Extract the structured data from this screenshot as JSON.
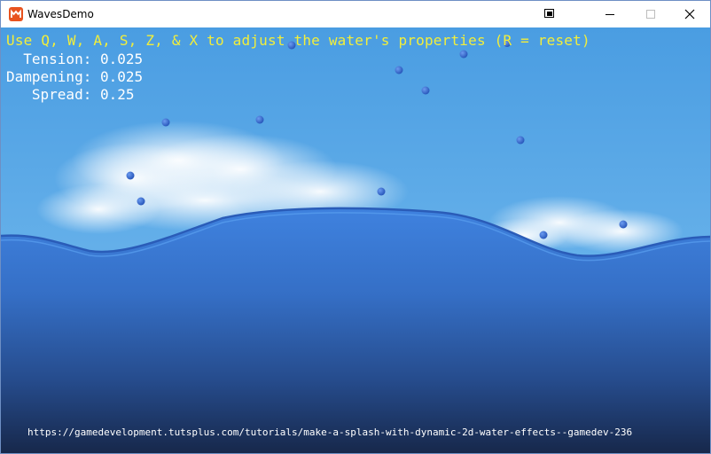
{
  "window": {
    "title": "WavesDemo",
    "controls": {
      "extra_icon": "snap-layout-icon",
      "minimize_icon": "minimize-icon",
      "maximize_icon": "maximize-icon",
      "close_icon": "close-icon"
    }
  },
  "hud": {
    "hint": "Use Q, W, A, S, Z, & X to adjust the water's properties (R = reset)",
    "tension_label": "  Tension:",
    "tension_value": "0.025",
    "dampening_label": "Dampening:",
    "dampening_value": "0.025",
    "spread_label": "   Spread:",
    "spread_value": "0.25",
    "url": "https://gamedevelopment.tutsplus.com/tutorials/make-a-splash-with-dynamic-2d-water-effects--gamedev-236"
  },
  "colors": {
    "sky_top": "#4b9ee2",
    "sky_bottom": "#6fb7ee",
    "water_top": "#3f7fdc",
    "water_bottom": "#1a2f58",
    "droplet": "#2f63c9",
    "hint_text": "#f2ee3a"
  }
}
